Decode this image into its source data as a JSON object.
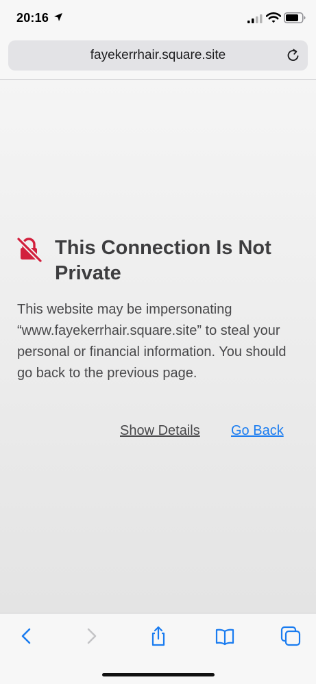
{
  "status_bar": {
    "time": "20:16",
    "icons": [
      "location-arrow-icon",
      "cellular-signal-icon",
      "wifi-icon",
      "battery-icon"
    ]
  },
  "address_bar": {
    "url": "fayekerrhair.square.site",
    "reload_icon": "reload-icon"
  },
  "error_page": {
    "icon": "broken-lock-icon",
    "icon_color": "#d21f3c",
    "title": "This Connection Is Not Private",
    "message": "This website may be impersonating “www.fayekerrhair.square.site” to steal your personal or financial information. You should go back to the previous page.",
    "show_details_label": "Show Details",
    "go_back_label": "Go Back",
    "link_color": "#1a7cf0"
  },
  "toolbar": {
    "buttons": [
      "back-icon",
      "forward-icon",
      "share-icon",
      "bookmarks-icon",
      "tabs-icon"
    ],
    "accent": "#1a7cf0"
  }
}
